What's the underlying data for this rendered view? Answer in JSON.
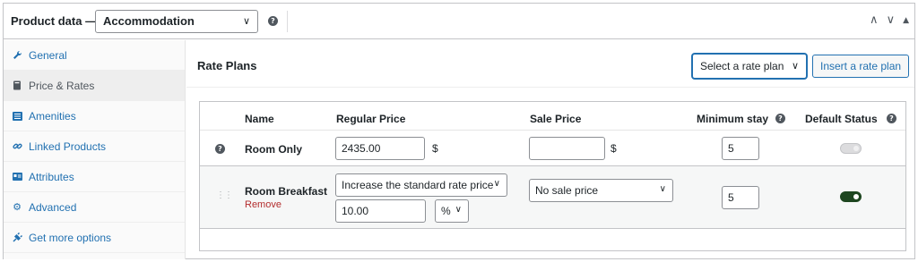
{
  "header": {
    "title": "Product data —",
    "product_type": "Accommodation",
    "help": "?",
    "controls": [
      "∧",
      "∨",
      "▲"
    ]
  },
  "sidebar": {
    "items": [
      {
        "label": "General",
        "icon": "wrench-icon",
        "active": false
      },
      {
        "label": "Price & Rates",
        "icon": "book-icon",
        "active": true
      },
      {
        "label": "Amenities",
        "icon": "list-icon",
        "active": false
      },
      {
        "label": "Linked Products",
        "icon": "link-icon",
        "active": false
      },
      {
        "label": "Attributes",
        "icon": "id-card-icon",
        "active": false
      },
      {
        "label": "Advanced",
        "icon": "gear-icon",
        "active": false
      },
      {
        "label": "Get more options",
        "icon": "plugin-icon",
        "active": false
      }
    ]
  },
  "rate_plans": {
    "title": "Rate Plans",
    "select_label": "Select a rate plan",
    "insert_label": "Insert a rate plan",
    "columns": {
      "name": "Name",
      "regular_price": "Regular Price",
      "sale_price": "Sale Price",
      "minimum_stay": "Minimum stay",
      "default_status": "Default Status"
    },
    "currency": "$",
    "rows": [
      {
        "name": "Room Only",
        "regular_price": "2435.00",
        "sale_price": "",
        "minimum_stay": "5",
        "default_on": false
      },
      {
        "name": "Room Breakfast",
        "remove": "Remove",
        "price_mode": "Increase the standard rate price",
        "price_value": "10.00",
        "price_unit": "%",
        "sale_mode": "No sale price",
        "minimum_stay": "5",
        "default_on": true
      }
    ]
  },
  "colors": {
    "link": "#2271b1",
    "remove": "#b32d2e",
    "toggle_on": "#1e4620"
  }
}
